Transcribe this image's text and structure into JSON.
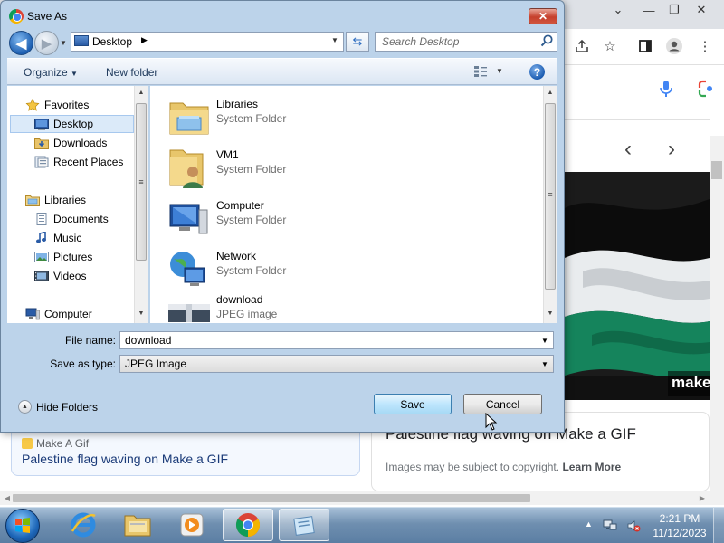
{
  "dialog": {
    "title": "Save As",
    "close_glyph": "✕",
    "address": {
      "location": "Desktop"
    },
    "search": {
      "placeholder": "Search Desktop"
    },
    "commands": {
      "organize": "Organize",
      "new_folder": "New folder"
    },
    "nav": {
      "items": [
        {
          "label": "Favorites",
          "icon": "star-icon"
        },
        {
          "label": "Desktop",
          "icon": "desktop-icon",
          "selected": true
        },
        {
          "label": "Downloads",
          "icon": "downloads-folder-icon"
        },
        {
          "label": "Recent Places",
          "icon": "recent-places-icon"
        },
        {
          "label": "Libraries",
          "icon": "libraries-icon"
        },
        {
          "label": "Documents",
          "icon": "documents-icon"
        },
        {
          "label": "Music",
          "icon": "music-icon"
        },
        {
          "label": "Pictures",
          "icon": "pictures-icon"
        },
        {
          "label": "Videos",
          "icon": "videos-icon"
        },
        {
          "label": "Computer",
          "icon": "computer-icon"
        }
      ]
    },
    "files": [
      {
        "name": "Libraries",
        "type": "System Folder",
        "icon": "libraries-folder-icon"
      },
      {
        "name": "VM1",
        "type": "System Folder",
        "icon": "user-folder-icon"
      },
      {
        "name": "Computer",
        "type": "System Folder",
        "icon": "computer-icon"
      },
      {
        "name": "Network",
        "type": "System Folder",
        "icon": "network-icon"
      },
      {
        "name": "download",
        "type": "JPEG image",
        "icon": "image-thumbnail-icon"
      }
    ],
    "file_name_label": "File name:",
    "file_name_value": "download",
    "save_type_label": "Save as type:",
    "save_type_value": "JPEG Image",
    "hide_folders": "Hide Folders",
    "save_button": "Save",
    "cancel_button": "Cancel"
  },
  "browser": {
    "window_controls": [
      "⌄",
      "—",
      "❐",
      "✕"
    ],
    "result_card": {
      "title": "Palestine flag waving on Make a GIF",
      "copyright_note": "Images may be subject to copyright.",
      "learn_more": "Learn More"
    },
    "left_card": {
      "site": "Make A Gif",
      "title": "Palestine flag waving on Make a GIF"
    },
    "watermark": "make"
  },
  "taskbar": {
    "time": "2:21 PM",
    "date": "11/12/2023",
    "apps": [
      "internet-explorer-icon",
      "file-explorer-icon",
      "media-player-icon",
      "chrome-icon",
      "notepad-icon"
    ]
  },
  "colors": {
    "dialog_frame": "#bcd3ea",
    "selection": "#dbeaf9",
    "taskbar": "#6f8fb0",
    "link_blue": "#1a3a78"
  }
}
